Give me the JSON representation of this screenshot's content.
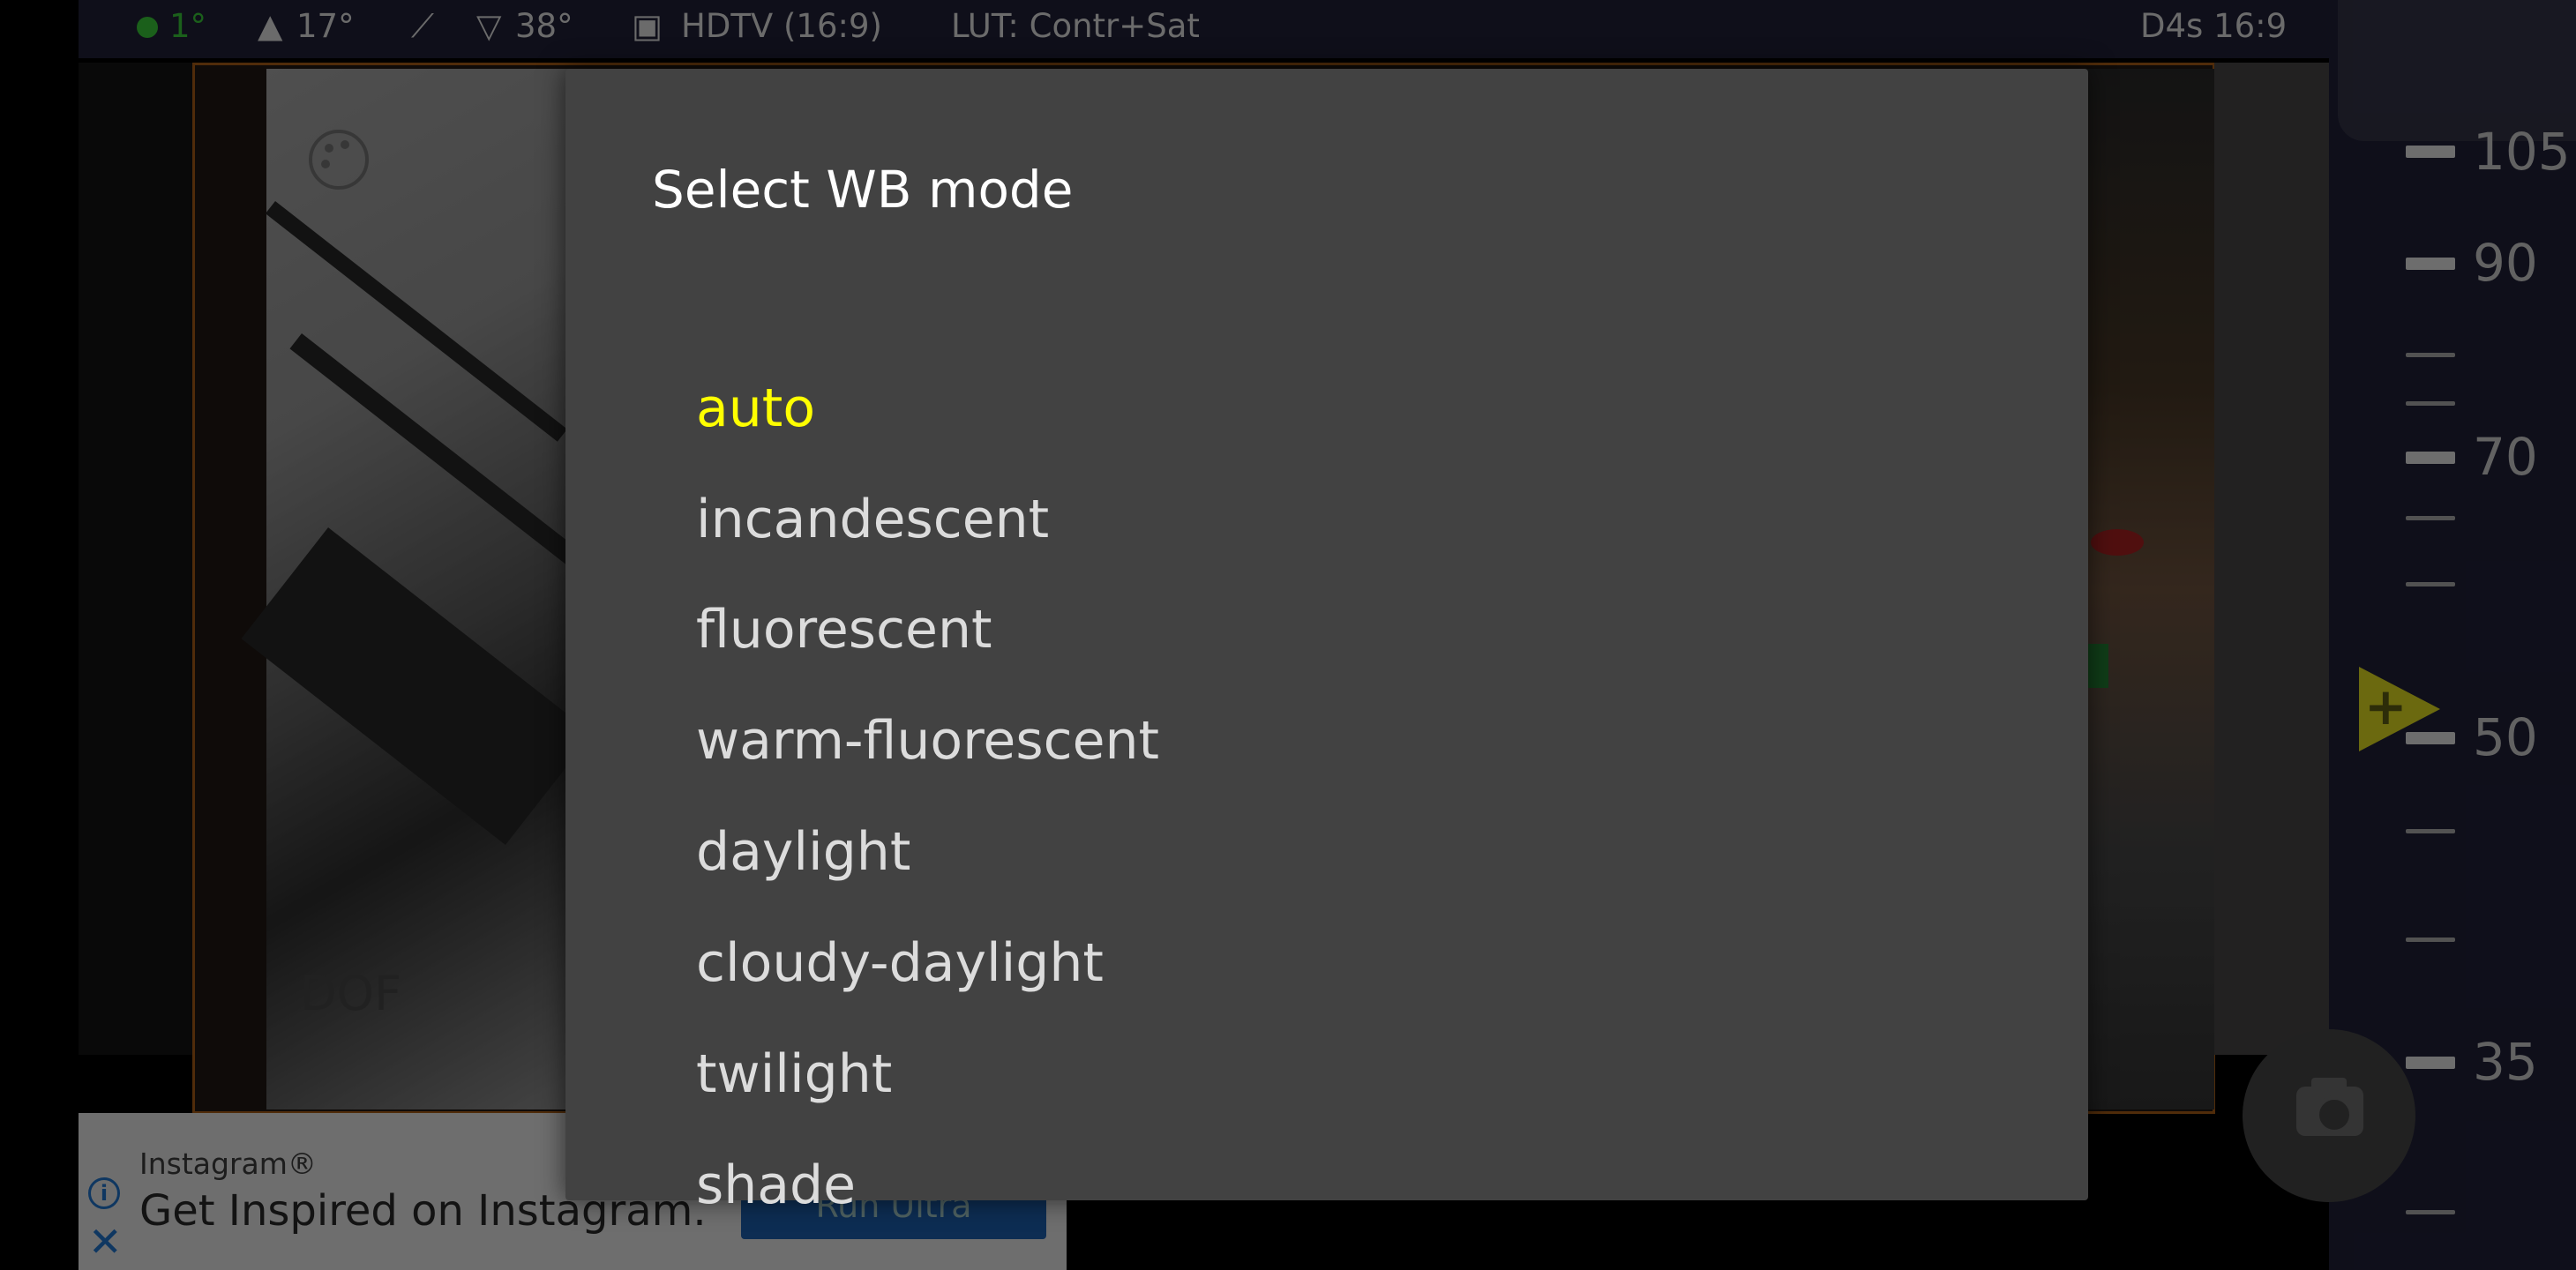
{
  "status_bar": {
    "level": "1°",
    "pitch": "17°",
    "compass": "38°",
    "resolution": "HDTV (16:9)",
    "lut": "LUT: Contr+Sat",
    "camera_mode": "D4s 16:9",
    "icons": [
      "level-dot-icon",
      "pitch-arrow-icon",
      "compass-feather-icon",
      "angle-icon",
      "screen-aspect-icon"
    ]
  },
  "zoom_scale": {
    "labels": [
      "105",
      "90",
      "70",
      "50",
      "35"
    ],
    "pointer_icon": "zoom-pointer-icon",
    "pointer_color": "#b8b61a",
    "current_label": "50"
  },
  "viewfinder": {
    "dof_label": "DOF",
    "palette_icon": "palette-icon",
    "frame_color": "#8a4c12"
  },
  "shutter": {
    "icon": "camera-icon"
  },
  "ad": {
    "brand": "Instagram®",
    "headline": "Get Inspired on Instagram.",
    "cta": "Run Ultra",
    "info_icon": "info-icon",
    "close_icon": "close-icon",
    "accent": "#1a5fa8"
  },
  "dialog": {
    "title": "Select WB mode",
    "options": [
      "auto",
      "incandescent",
      "fluorescent",
      "warm-fluorescent",
      "daylight",
      "cloudy-daylight",
      "twilight",
      "shade"
    ],
    "selected": "auto",
    "selected_color": "#ffff00",
    "background": "#424242"
  }
}
